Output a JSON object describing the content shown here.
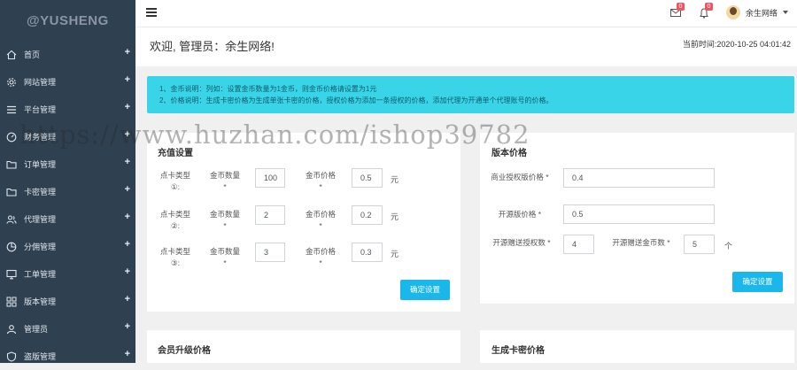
{
  "sidebar": {
    "logo": "@YUSHENG",
    "items": [
      {
        "label": "首页",
        "icon": "home-icon"
      },
      {
        "label": "网站管理",
        "icon": "gear-icon"
      },
      {
        "label": "平台管理",
        "icon": "list-icon"
      },
      {
        "label": "财务管理",
        "icon": "dashboard-icon"
      },
      {
        "label": "订单管理",
        "icon": "folder-icon"
      },
      {
        "label": "卡密管理",
        "icon": "folder-icon"
      },
      {
        "label": "代理管理",
        "icon": "users-icon"
      },
      {
        "label": "分佣管理",
        "icon": "pie-icon"
      },
      {
        "label": "工单管理",
        "icon": "monitor-icon"
      },
      {
        "label": "版本管理",
        "icon": "grid-icon"
      },
      {
        "label": "管理员",
        "icon": "user-icon"
      },
      {
        "label": "盗版管理",
        "icon": "shield-icon"
      }
    ]
  },
  "topbar": {
    "mail_badge": "0",
    "bell_badge": "0",
    "user_name": "余生网络"
  },
  "welcome": {
    "title": "欢迎, 管理员：余生网络!",
    "time": "当前时间:2020-10-25 04:01:42"
  },
  "notice": {
    "line1": "1、金币说明：列如：设置金币数量为1金币，则金币价格请设置为1元",
    "line2": "2、价格说明：生成卡密价格为生成单张卡密的价格，授权价格为添加一条授权的价格，添加代理为开通单个代理账号的价格。"
  },
  "recharge": {
    "title": "充值设置",
    "rows": [
      {
        "type_label": "点卡类型①:",
        "coin_label": "金币数量 *",
        "coin_value": "100",
        "price_label": "金币价格 *",
        "price_value": "0.5",
        "unit": "元"
      },
      {
        "type_label": "点卡类型②:",
        "coin_label": "金币数量 *",
        "coin_value": "2",
        "price_label": "金币价格 *",
        "price_value": "0.2",
        "unit": "元"
      },
      {
        "type_label": "点卡类型③:",
        "coin_label": "金币数量 *",
        "coin_value": "3",
        "price_label": "金币价格 *",
        "price_value": "0.3",
        "unit": "元"
      }
    ],
    "submit": "确定设置"
  },
  "version": {
    "title": "版本价格",
    "commercial_label": "商业授权版价格 *",
    "commercial_value": "0.4",
    "open_label": "开源版价格 *",
    "open_value": "0.5",
    "gift_auth_label": "开源赠送授权数 *",
    "gift_auth_value": "4",
    "gift_coin_label": "开源赠送金币数 *",
    "gift_coin_value": "5",
    "gift_coin_unit": "个",
    "submit": "确定设置"
  },
  "member": {
    "title": "会员升级价格"
  },
  "cardgen": {
    "title": "生成卡密价格"
  },
  "watermark": "https://www.huzhan.com/ishop39782"
}
